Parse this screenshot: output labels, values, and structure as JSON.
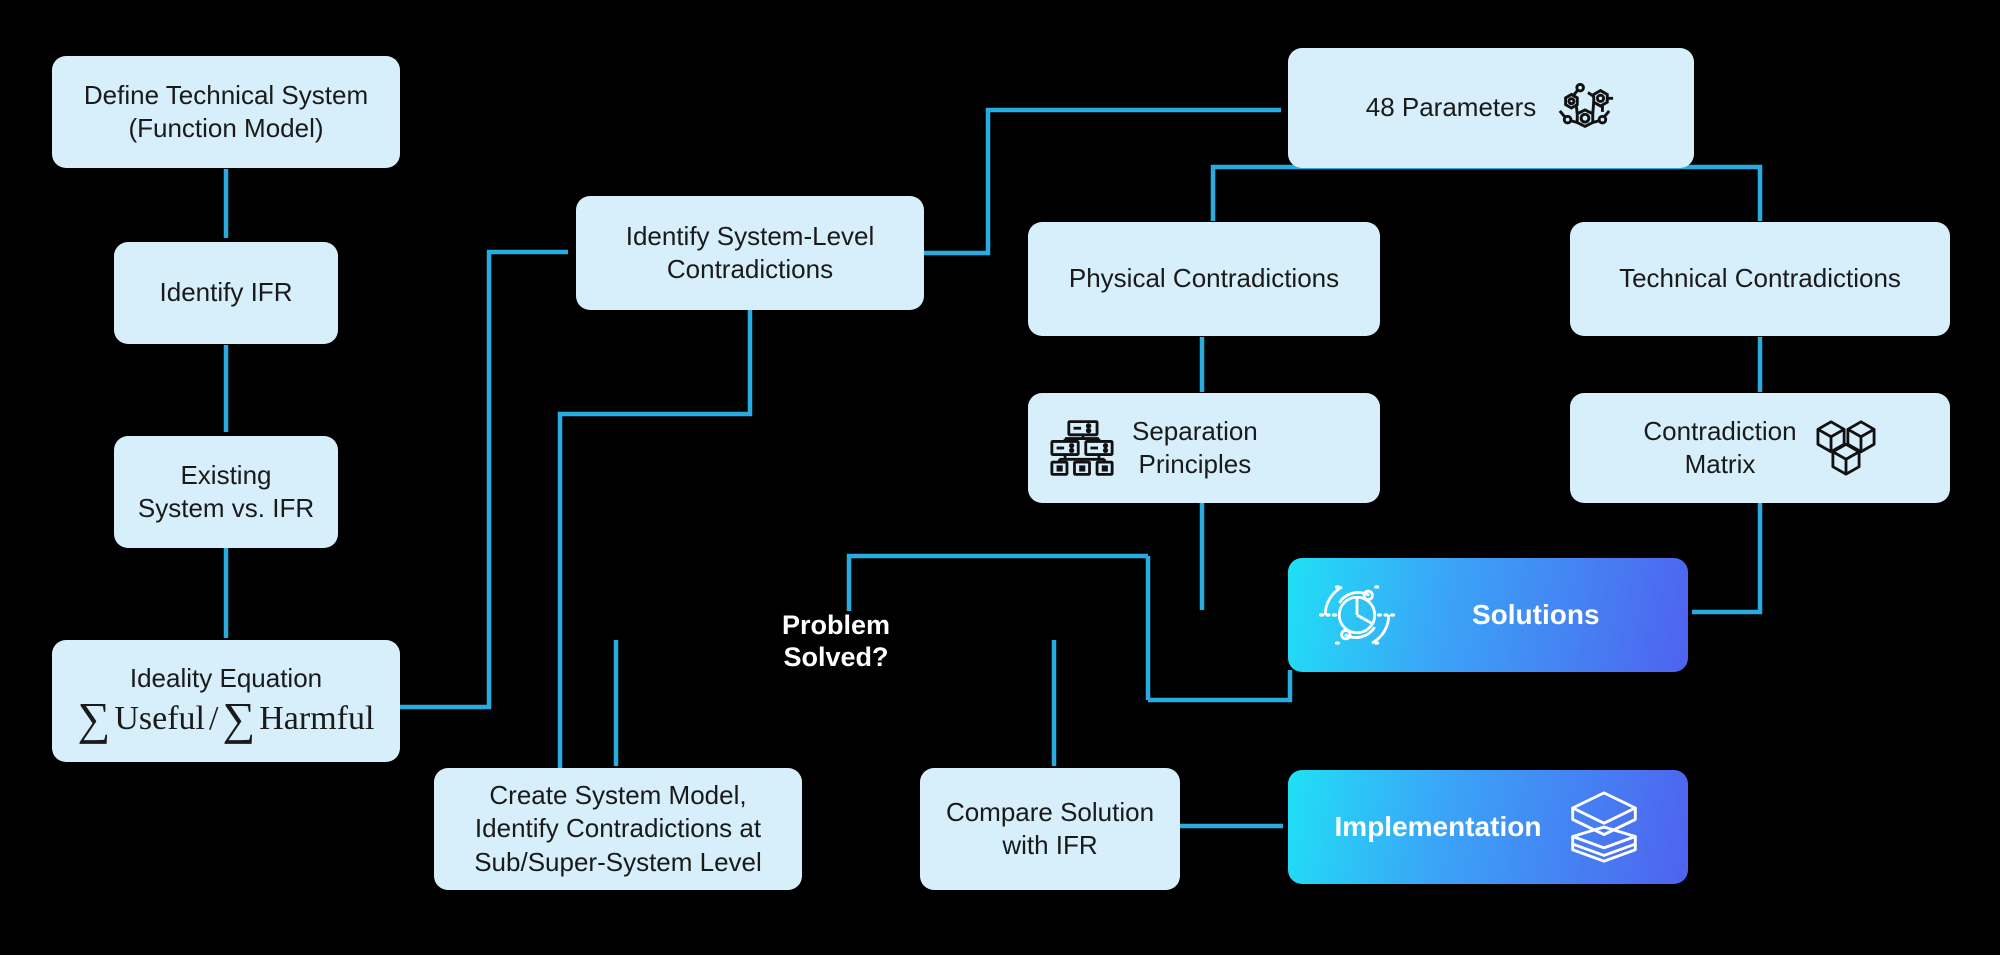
{
  "diagram": {
    "title": "TRIZ Problem Solving Flowchart",
    "colors": {
      "background": "#000000",
      "node_fill": "#d7eefb",
      "arrow": "#29abe2",
      "gradient_start": "#20e0f5",
      "gradient_mid": "#3aa5f7",
      "gradient_end": "#4f62ef",
      "node_text": "#1a1a1a",
      "gradient_text": "#ffffff"
    }
  },
  "nodes": {
    "define_system": {
      "label": "Define Technical System\n(Function Model)"
    },
    "identify_ifr": {
      "label": "Identify IFR"
    },
    "existing_vs_ifr": {
      "label": "Existing\nSystem vs. IFR"
    },
    "ideality": {
      "title": "Ideality Equation",
      "sum_symbol": "∑",
      "numerator": "Useful",
      "divider": "/",
      "denominator": "Harmful"
    },
    "identify_contradictions": {
      "label": "Identify System-Level\nContradictions"
    },
    "parameters": {
      "label": "48 Parameters",
      "icon": "molecule-network-icon"
    },
    "physical_contradictions": {
      "label": "Physical Contradictions"
    },
    "technical_contradictions": {
      "label": "Technical Contradictions"
    },
    "separation_principles": {
      "label": "Separation\nPrinciples",
      "icon": "hierarchy-tree-icon"
    },
    "contradiction_matrix": {
      "label": "Contradiction\nMatrix",
      "icon": "cubes-icon"
    },
    "solutions": {
      "label": "Solutions",
      "icon": "analytics-circle-icon"
    },
    "implementation": {
      "label": "Implementation",
      "icon": "stacked-layers-icon"
    },
    "problem_solved": {
      "label": "Problem\nSolved?"
    },
    "create_system_model": {
      "label": "Create System Model,\nIdentify Contradictions at\nSub/Super-System Level"
    },
    "compare_solution": {
      "label": "Compare Solution\nwith IFR"
    }
  }
}
